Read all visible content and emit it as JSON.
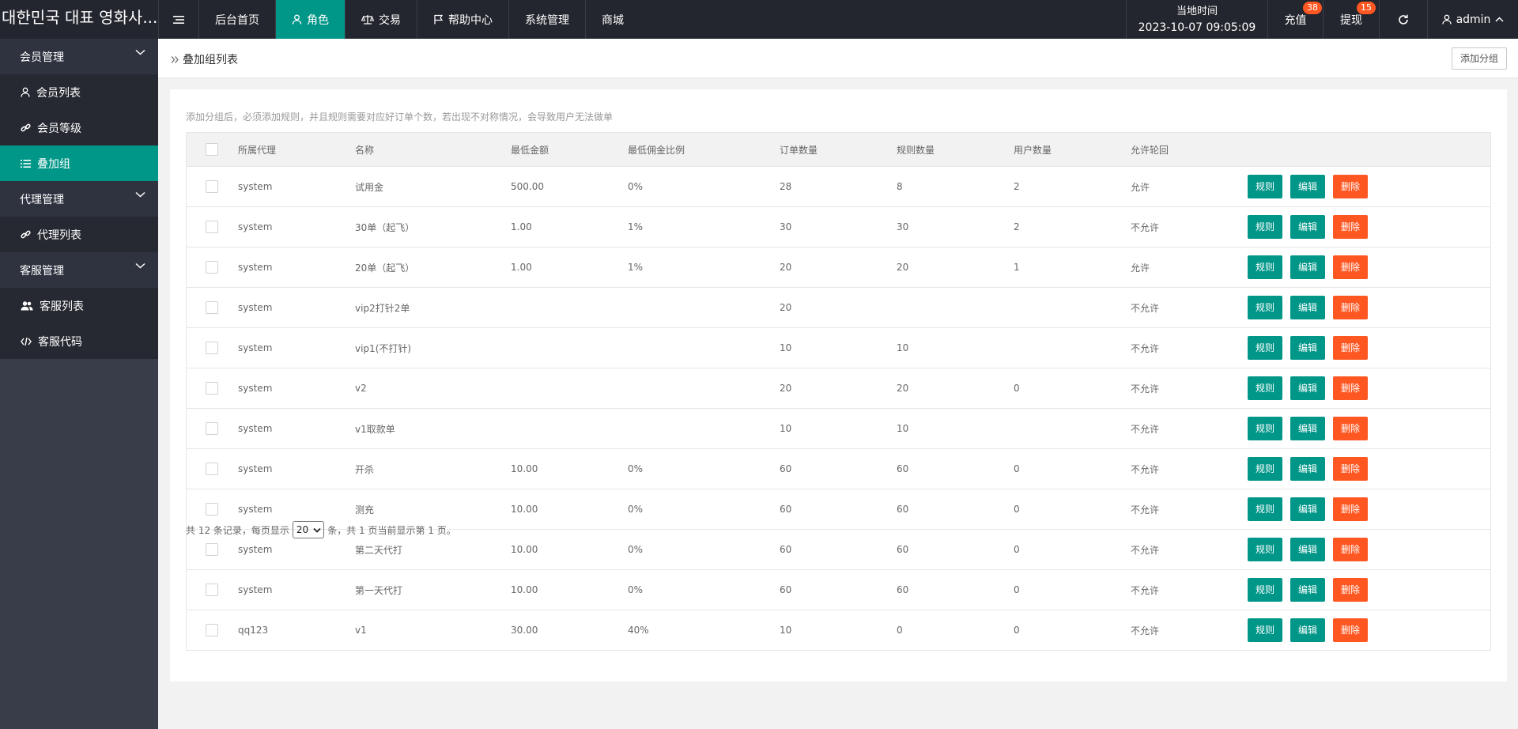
{
  "app": {
    "title": "대한민국 대표 영화사..."
  },
  "topnav": {
    "items": [
      {
        "label": "后台首页"
      },
      {
        "label": "角色"
      },
      {
        "label": "交易"
      },
      {
        "label": "帮助中心"
      },
      {
        "label": "系统管理"
      },
      {
        "label": "商城"
      }
    ],
    "active_index": 1
  },
  "topright": {
    "time_label": "当地时间",
    "time_value": "2023-10-07 09:05:09",
    "recharge_label": "充值",
    "recharge_badge": "38",
    "withdraw_label": "提现",
    "withdraw_badge": "15",
    "user": "admin"
  },
  "sidebar": {
    "groups": [
      {
        "label": "会员管理",
        "items": [
          {
            "label": "会员列表",
            "icon": "user-icon"
          },
          {
            "label": "会员等级",
            "icon": "link-icon"
          },
          {
            "label": "叠加组",
            "icon": "list-icon",
            "active": true
          }
        ]
      },
      {
        "label": "代理管理",
        "items": [
          {
            "label": "代理列表",
            "icon": "link-icon"
          }
        ]
      },
      {
        "label": "客服管理",
        "items": [
          {
            "label": "客服列表",
            "icon": "users-icon"
          },
          {
            "label": "客服代码",
            "icon": "code-icon"
          }
        ]
      }
    ]
  },
  "breadcrumb": {
    "label": "叠加组列表"
  },
  "toolbar": {
    "add_group_label": "添加分组"
  },
  "tip": "添加分组后，必须添加规则，并且规则需要对应好订单个数，若出现不对称情况，会导致用户无法做单",
  "table": {
    "columns": [
      "所属代理",
      "名称",
      "最低金额",
      "最低佣金比例",
      "订单数量",
      "规则数量",
      "用户数量",
      "允许轮回"
    ],
    "action_labels": {
      "rule": "规则",
      "edit": "编辑",
      "delete": "删除"
    },
    "rows": [
      [
        "system",
        "试用金",
        "500.00",
        "0%",
        "28",
        "8",
        "2",
        "允许"
      ],
      [
        "system",
        "30单（起飞）",
        "1.00",
        "1%",
        "30",
        "30",
        "2",
        "不允许"
      ],
      [
        "system",
        "20单（起飞）",
        "1.00",
        "1%",
        "20",
        "20",
        "1",
        "允许"
      ],
      [
        "system",
        "vip2打针2单",
        "",
        "",
        "20",
        "",
        "",
        "不允许"
      ],
      [
        "system",
        "vip1(不打针)",
        "",
        "",
        "10",
        "10",
        "",
        "不允许"
      ],
      [
        "system",
        "v2",
        "",
        "",
        "20",
        "20",
        "0",
        "不允许"
      ],
      [
        "system",
        "v1取款单",
        "",
        "",
        "10",
        "10",
        "",
        "不允许"
      ],
      [
        "system",
        "开杀",
        "10.00",
        "0%",
        "60",
        "60",
        "0",
        "不允许"
      ],
      [
        "system",
        "测充",
        "10.00",
        "0%",
        "60",
        "60",
        "0",
        "不允许"
      ],
      [
        "system",
        "第二天代打",
        "10.00",
        "0%",
        "60",
        "60",
        "0",
        "不允许"
      ],
      [
        "system",
        "第一天代打",
        "10.00",
        "0%",
        "60",
        "60",
        "0",
        "不允许"
      ],
      [
        "qq123",
        "v1",
        "30.00",
        "40%",
        "10",
        "0",
        "0",
        "不允许"
      ]
    ]
  },
  "pager": {
    "prefix": "共 12 条记录，每页显示",
    "per_page": "20",
    "suffix": "条，共 1 页当前显示第 1 页。"
  },
  "colors": {
    "accent": "#009688",
    "danger": "#ff5722",
    "topbar": "#23262e",
    "sidebar": "#393d49"
  }
}
